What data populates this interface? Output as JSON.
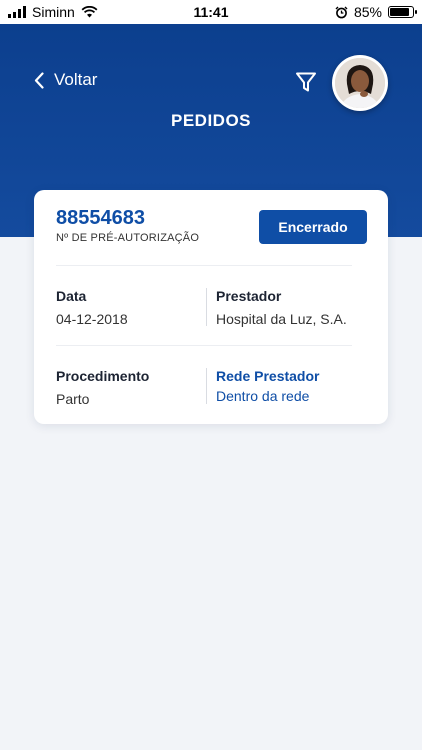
{
  "status_bar": {
    "carrier": "Siminn",
    "time": "11:41",
    "battery": "85%",
    "battery_level": 0.85
  },
  "header": {
    "back_label": "Voltar",
    "title": "PEDIDOS"
  },
  "card": {
    "order_number": "88554683",
    "order_caption": "Nº DE PRÉ-AUTORIZAÇÃO",
    "status_button": "Encerrado",
    "date_label": "Data",
    "date_value": "04-12-2018",
    "provider_label": "Prestador",
    "provider_value": "Hospital da Luz, S.A.",
    "procedure_label": "Procedimento",
    "procedure_value": "Parto",
    "network_label": "Rede Prestador",
    "network_value": "Dentro da rede"
  },
  "colors": {
    "brand": "#0f4ea6",
    "header_bg": "#0c3f8e",
    "page_bg": "#f2f4f8"
  },
  "icons": [
    "back-chevron-icon",
    "filter-icon",
    "wifi-icon",
    "alarm-icon",
    "signal-icon",
    "battery-icon"
  ]
}
